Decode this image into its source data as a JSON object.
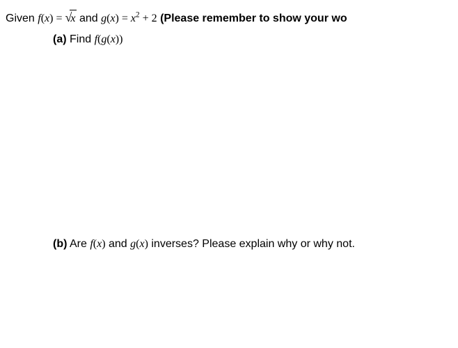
{
  "given": {
    "prefix": "Given ",
    "f_lhs_f": "f",
    "f_lhs_open": "(",
    "f_lhs_x": "x",
    "f_lhs_close": ") = ",
    "sqrt_arg": "x",
    "and": " and ",
    "g_lhs_g": "g",
    "g_lhs_open": "(",
    "g_lhs_x": "x",
    "g_lhs_close": ") = ",
    "g_rhs_x": "x",
    "g_rhs_exp": "2",
    "g_rhs_tail": " + 2",
    "reminder": "  (Please remember to show your wo"
  },
  "partA": {
    "label": "(a)",
    "text": "  Find ",
    "f": "f",
    "open1": "(",
    "g": "g",
    "open2": "(",
    "x": "x",
    "close": "))"
  },
  "partB": {
    "label": "(b)",
    "text1": "  Are ",
    "f": "f",
    "f_open": "(",
    "f_x": "x",
    "f_close": ")",
    "and": " and ",
    "g": "g",
    "g_open": "(",
    "g_x": "x",
    "g_close": ")",
    "text2": " inverses? Please explain why or why not."
  }
}
